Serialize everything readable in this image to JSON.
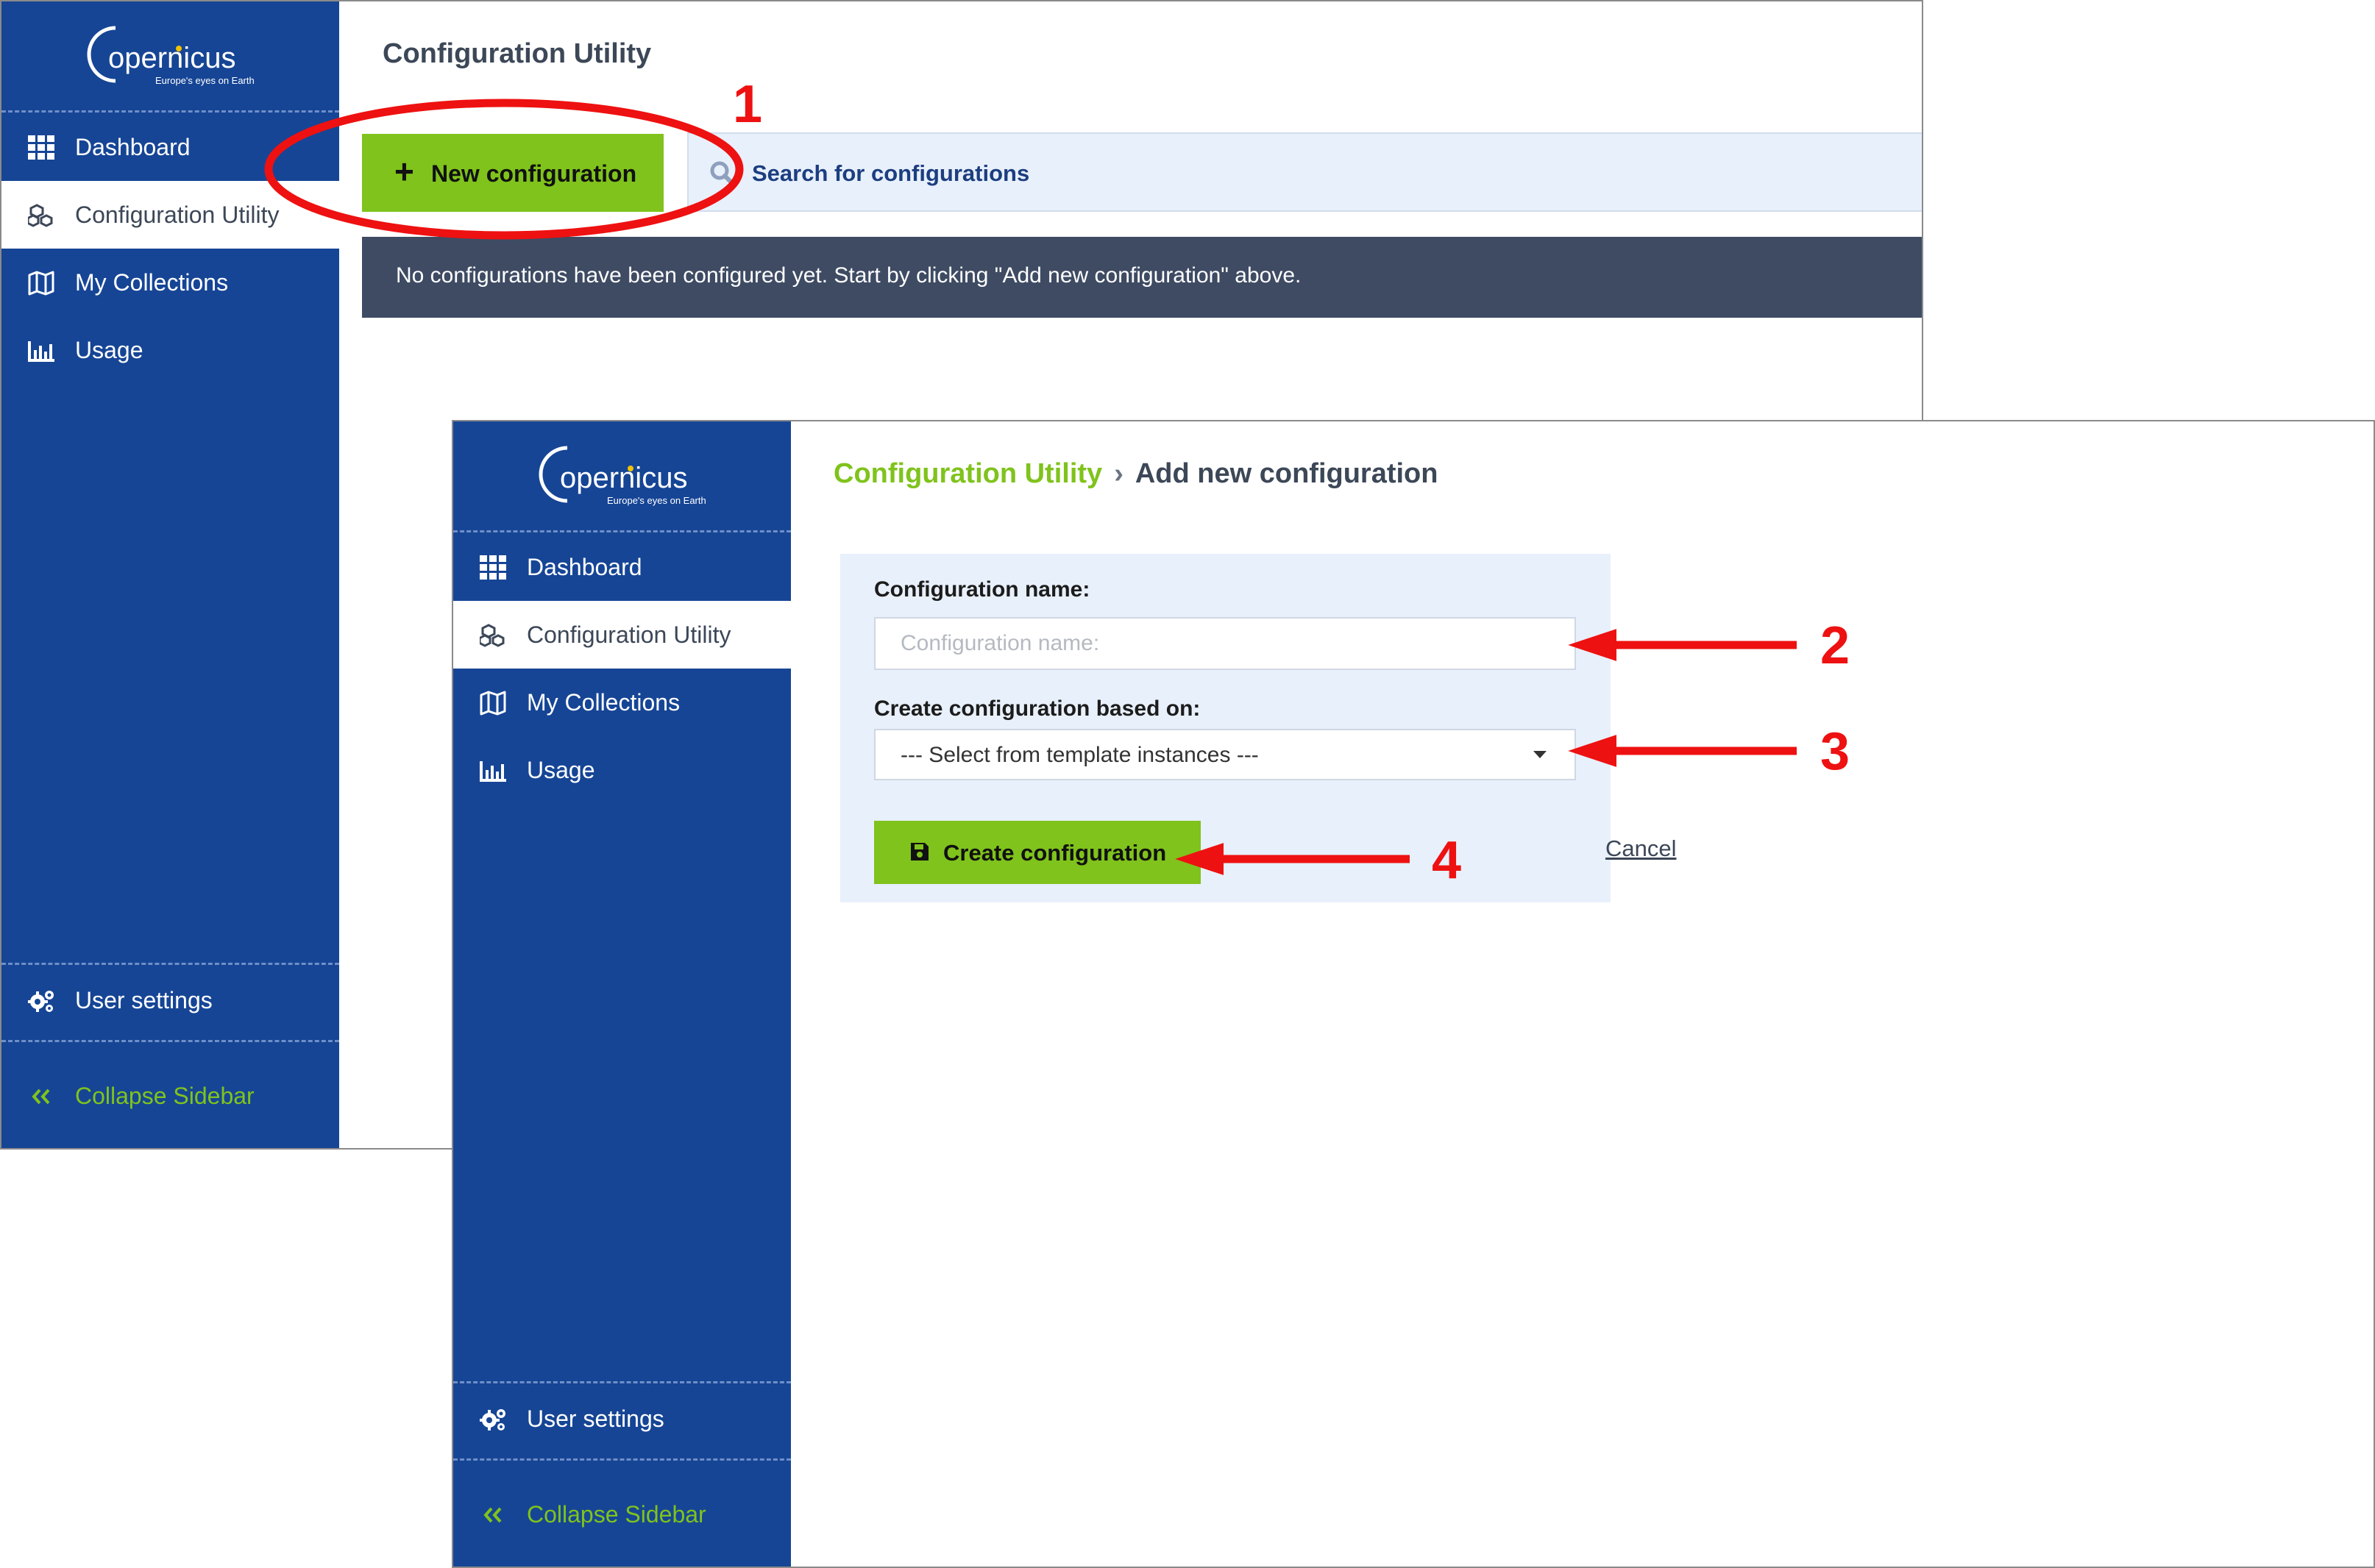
{
  "brand": {
    "logo_main": "opernicus",
    "logo_sub": "Europe's eyes on Earth"
  },
  "sidebar": {
    "items": [
      {
        "label": "Dashboard",
        "icon": "grid-icon"
      },
      {
        "label": "Configuration Utility",
        "icon": "cubes-icon"
      },
      {
        "label": "My Collections",
        "icon": "map-icon"
      },
      {
        "label": "Usage",
        "icon": "bar-chart-icon"
      }
    ],
    "user_settings": {
      "label": "User settings",
      "icon": "gears-icon"
    },
    "collapse": {
      "label": "Collapse Sidebar",
      "icon": "double-chevron-left-icon"
    }
  },
  "list_view": {
    "title": "Configuration Utility",
    "new_button": "New configuration",
    "search_placeholder": "Search for configurations",
    "empty_message": "No configurations have been configured yet. Start by clicking \"Add new configuration\" above."
  },
  "form_view": {
    "breadcrumb_parent": "Configuration Utility",
    "breadcrumb_separator": "›",
    "breadcrumb_current": "Add new configuration",
    "name_label": "Configuration name:",
    "name_placeholder": "Configuration name:",
    "based_on_label": "Create configuration based on:",
    "based_on_selected": "--- Select from template instances ---",
    "create_button": "Create configuration",
    "cancel_link": "Cancel"
  },
  "annotations": {
    "steps": [
      "1",
      "2",
      "3",
      "4"
    ]
  },
  "colors": {
    "sidebar_bg": "#164595",
    "accent_green": "#7fc31c",
    "notice_bg": "#3e4b63",
    "search_bg": "#e8f0fb",
    "annotation_red": "#ee1111"
  }
}
